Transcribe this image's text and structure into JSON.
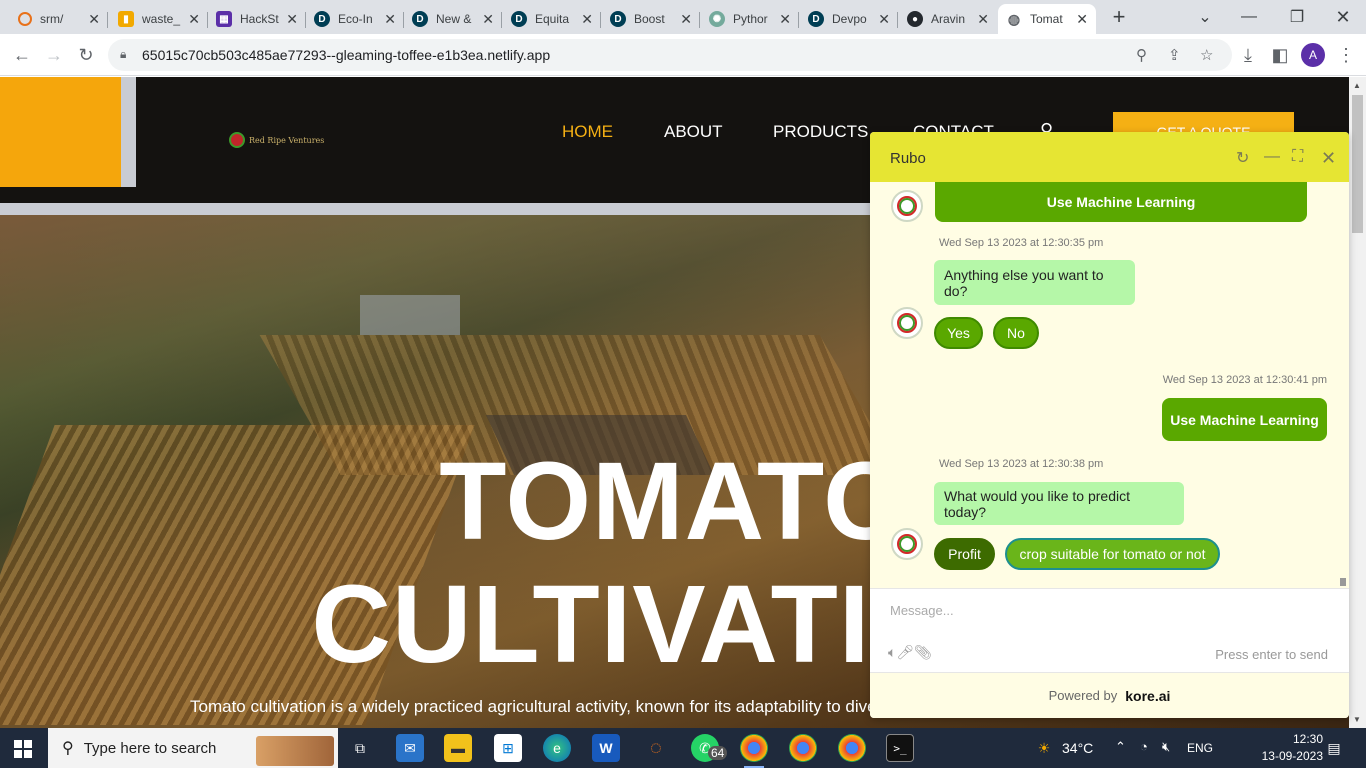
{
  "browser": {
    "tabs": [
      {
        "title": "srm/",
        "icon": "spinner-icon",
        "color": "#e8711a"
      },
      {
        "title": "waste_",
        "icon": "notebook-icon",
        "color": "#f2a900"
      },
      {
        "title": "HackSt",
        "icon": "grid-icon",
        "color": "#5b2fa8"
      },
      {
        "title": "Eco-In",
        "icon": "devpost-icon",
        "color": "#003e54"
      },
      {
        "title": "New &",
        "icon": "devpost-icon",
        "color": "#003e54"
      },
      {
        "title": "Equita",
        "icon": "devpost-icon",
        "color": "#003e54"
      },
      {
        "title": "Boost",
        "icon": "devpost-icon",
        "color": "#003e54"
      },
      {
        "title": "Pythor",
        "icon": "openai-icon",
        "color": "#74aa9c"
      },
      {
        "title": "Devpo",
        "icon": "devpost-icon",
        "color": "#003e54"
      },
      {
        "title": "Aravin",
        "icon": "github-icon",
        "color": "#24292e"
      },
      {
        "title": "Tomat",
        "icon": "globe-icon",
        "color": "#5f6368"
      }
    ],
    "new_tab": "+",
    "url": "65015c70cb503c485ae77293--gleaming-toffee-e1b3ea.netlify.app",
    "profile_initial": "A"
  },
  "site": {
    "logo_text": "Red Ripe Ventures",
    "nav": [
      "HOME",
      "ABOUT",
      "PRODUCTS",
      "CONTACT"
    ],
    "quote_button": "GET A QUOTE",
    "hero_line1": "TOMATO",
    "hero_line2": "CULTIVATION",
    "hero_sub": "Tomato cultivation is a widely practiced agricultural activity, known for its adaptability to dive"
  },
  "chat": {
    "bot_name": "Rubo",
    "messages": {
      "top_user": "Use Machine Learning",
      "ts1": "Wed Sep 13 2023 at 12:30:35 pm",
      "bot1": "Anything else you want to do?",
      "chip_yes": "Yes",
      "chip_no": "No",
      "ts2": "Wed Sep 13 2023 at 12:30:41 pm",
      "user2": "Use Machine Learning",
      "ts3": "Wed Sep 13 2023 at 12:30:38 pm",
      "bot2": "What would you like to predict today?",
      "chip_profit": "Profit",
      "chip_crop": "crop suitable for tomato or not"
    },
    "input_placeholder": "Message...",
    "press_enter": "Press enter to send",
    "powered_by": "Powered by",
    "brand": "kore.ai"
  },
  "taskbar": {
    "search_placeholder": "Type here to search",
    "whatsapp_badge": "64",
    "weather": "34°C",
    "lang": "ENG",
    "time": "12:30",
    "date": "13-09-2023"
  }
}
